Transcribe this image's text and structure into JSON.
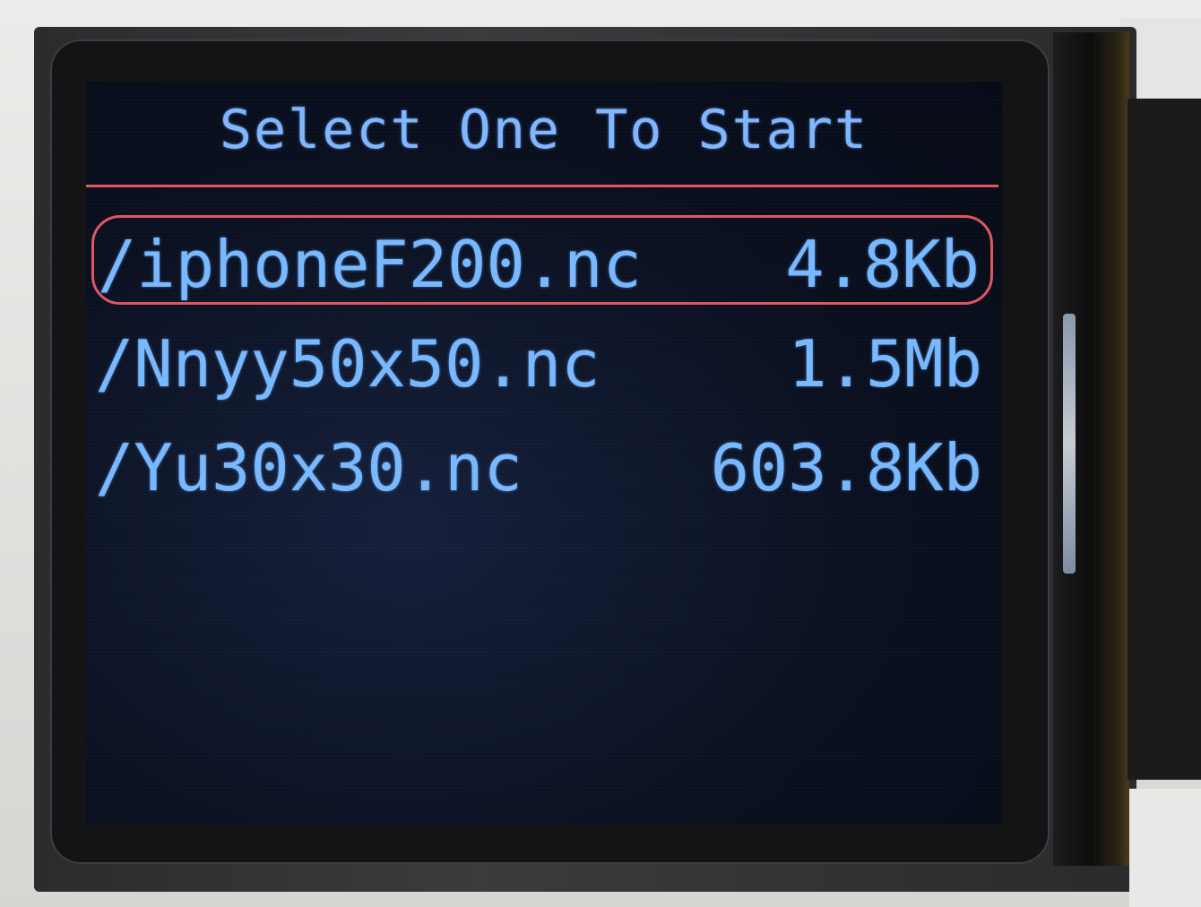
{
  "screen": {
    "title": "Select One To Start",
    "files": [
      {
        "name": "/iphoneF200.nc",
        "size": "4.8Kb",
        "selected": true
      },
      {
        "name": "/Nnyy50x50.nc",
        "size": "1.5Mb",
        "selected": false
      },
      {
        "name": "/Yu30x30.nc",
        "size": "603.8Kb",
        "selected": false
      }
    ]
  },
  "colors": {
    "text": "#78b8ff",
    "accent": "#e05560",
    "background": "#0a1020"
  }
}
